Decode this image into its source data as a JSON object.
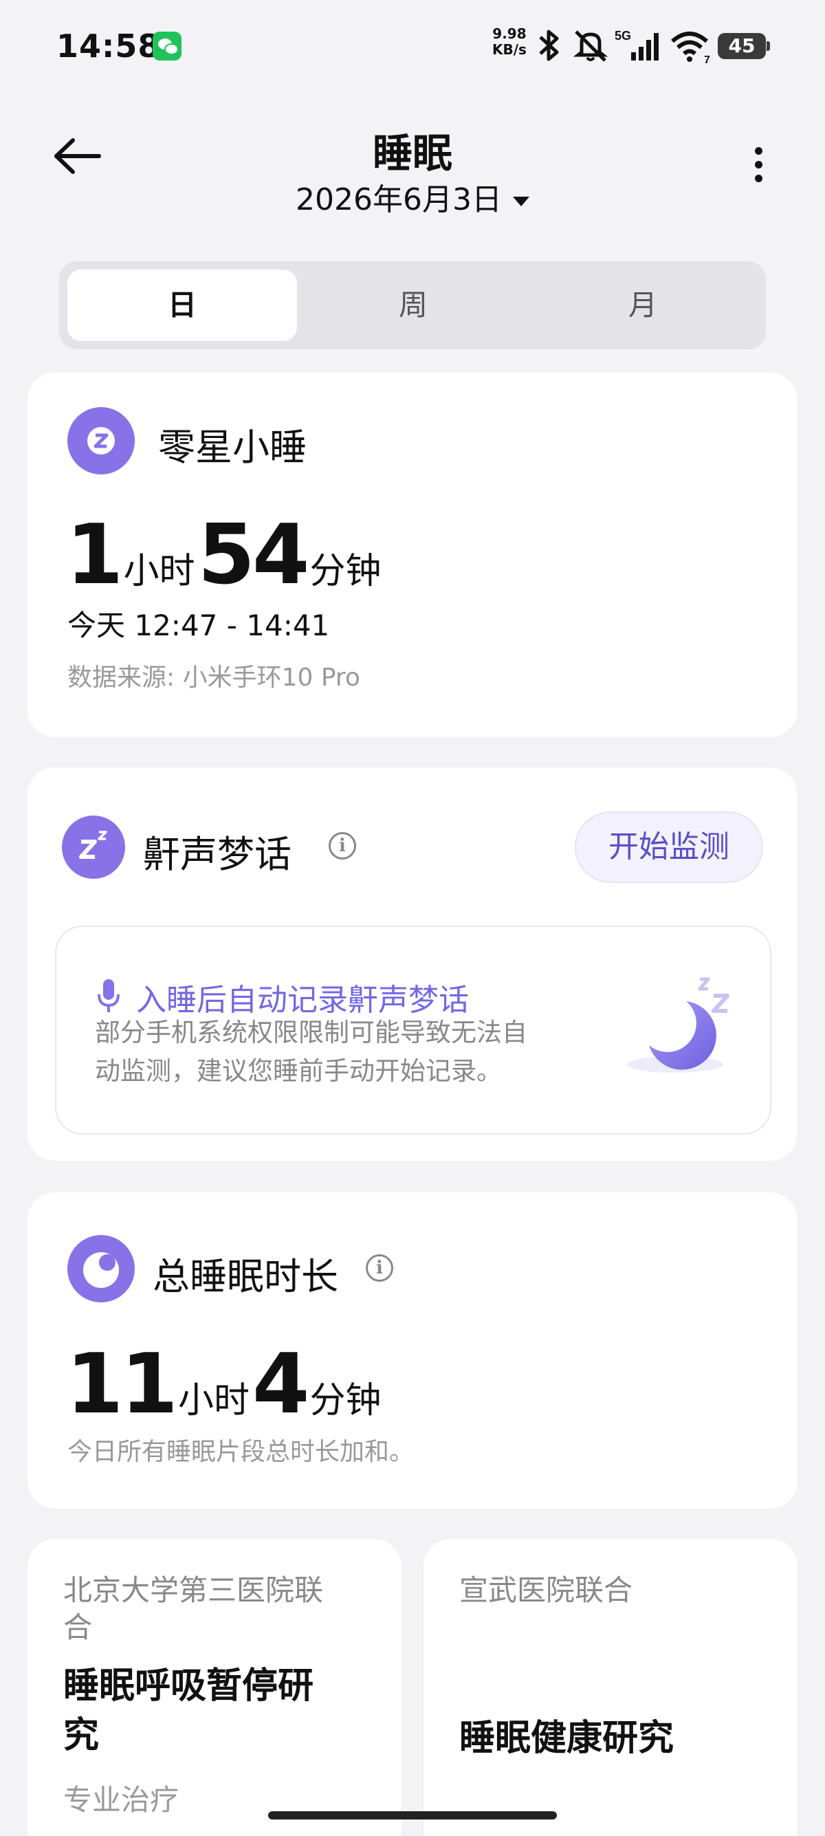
{
  "status_bar": {
    "time": "14:58",
    "net_speed_value": "9.98",
    "net_speed_unit": "KB/s",
    "signal_label": "5G",
    "wifi_label": "7",
    "battery": "45"
  },
  "header": {
    "title": "睡眠",
    "date": "2026年6月3日"
  },
  "tabs": [
    {
      "label": "日",
      "active": true
    },
    {
      "label": "周",
      "active": false
    },
    {
      "label": "月",
      "active": false
    }
  ],
  "nap_card": {
    "title": "零星小睡",
    "hours": "1",
    "hours_unit": "小时",
    "minutes": "54",
    "minutes_unit": "分钟",
    "time_range": "今天 12:47 - 14:41",
    "source": "数据来源: 小米手环10 Pro"
  },
  "snore_card": {
    "title": "鼾声梦话",
    "button": "开始监测",
    "tip_title": "入睡后自动记录鼾声梦话",
    "tip_line1": "部分手机系统权限限制可能导致无法自",
    "tip_line2": "动监测，建议您睡前手动开始记录。"
  },
  "total_card": {
    "title": "总睡眠时长",
    "hours": "11",
    "hours_unit": "小时",
    "minutes": "4",
    "minutes_unit": "分钟",
    "note": "今日所有睡眠片段总时长加和。"
  },
  "research_cards": [
    {
      "org_line1": "北京大学第三医院联",
      "org_line2": "合",
      "title_line1": "睡眠呼吸暂停研",
      "title_line2": "究",
      "tag": "专业治疗"
    },
    {
      "org_line1": "宣武医院联合",
      "title_line1": "睡眠健康研究"
    }
  ],
  "colors": {
    "accent": "#8772e8",
    "button_text": "#5a4fc8",
    "background": "#f3f3f5"
  }
}
